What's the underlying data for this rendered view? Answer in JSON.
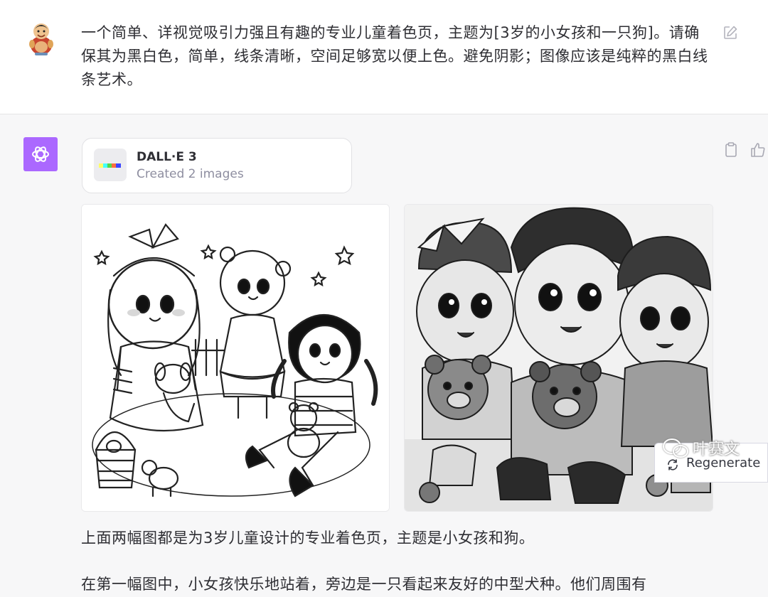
{
  "user_message": {
    "text": "一个简单、详视觉吸引力强且有趣的专业儿童着色页，主题为[3岁的小女孩和一只狗]。请确保其为黑白色，简单，线条清晰，空间足够宽以便上色。避免阴影；图像应该是纯粹的黑白线条艺术。"
  },
  "assistant": {
    "tool": {
      "name": "DALL·E 3",
      "status": "Created 2 images"
    },
    "images": [
      {
        "icon": "generated-image-1"
      },
      {
        "icon": "generated-image-2"
      }
    ],
    "response_p1": "上面两幅图都是为3岁儿童设计的专业着色页，主题是小女孩和狗。",
    "response_p2": "在第一幅图中，小女孩快乐地站着，旁边是一只看起来友好的中型犬种。他们周围有"
  },
  "regenerate": {
    "label": "Regenerate"
  },
  "watermark": {
    "text": "叶赛文"
  },
  "colors": {
    "accent": "#ab68ff",
    "background": "#f7f7f8"
  }
}
